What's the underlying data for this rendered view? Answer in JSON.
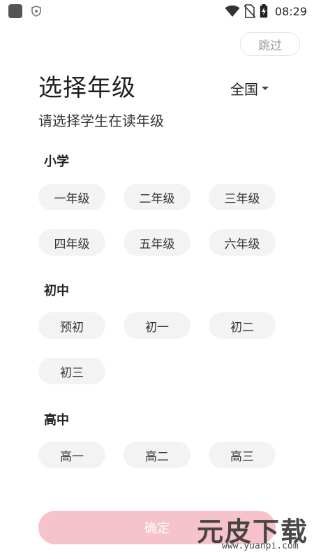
{
  "status_bar": {
    "time": "08:29"
  },
  "header": {
    "skip_label": "跳过",
    "title": "选择年级",
    "region": "全国",
    "subtitle": "请选择学生在读年级"
  },
  "sections": [
    {
      "title": "小学",
      "grades": [
        "一年级",
        "二年级",
        "三年级",
        "四年级",
        "五年级",
        "六年级"
      ]
    },
    {
      "title": "初中",
      "grades": [
        "预初",
        "初一",
        "初二",
        "初三"
      ]
    },
    {
      "title": "高中",
      "grades": [
        "高一",
        "高二",
        "高三"
      ]
    }
  ],
  "footer": {
    "confirm_label": "确定"
  },
  "watermark": {
    "brand": "元皮下载",
    "url": "www.yuanpi.com"
  },
  "colors": {
    "confirm_bg": "#f6c3cc",
    "chip_bg": "#f3f3f3"
  }
}
